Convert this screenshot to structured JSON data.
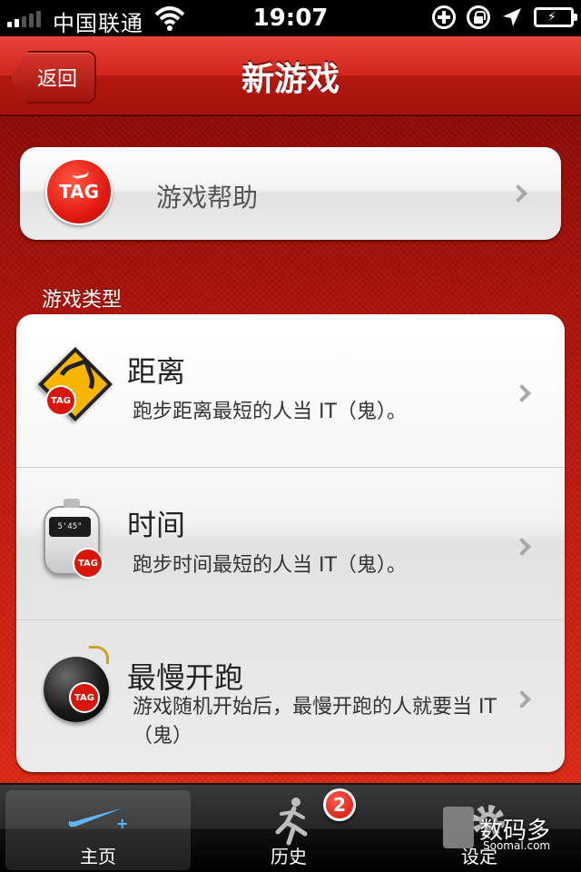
{
  "status_bar": {
    "carrier": "中国联通",
    "time": "19:07"
  },
  "nav": {
    "back_label": "返回",
    "title": "新游戏"
  },
  "help": {
    "icon_text": "TAG",
    "label": "游戏帮助"
  },
  "section": {
    "header": "游戏类型"
  },
  "game_types": [
    {
      "title": "距离",
      "description": "跑步距离最短的人当 IT（鬼）。",
      "icon": "distance-sign-icon",
      "icon_text": "TAG"
    },
    {
      "title": "时间",
      "description": "跑步时间最短的人当 IT（鬼）。",
      "icon": "stopwatch-icon",
      "icon_text": "TAG",
      "watch_display": "5'45\""
    },
    {
      "title": "最慢开跑",
      "description": "游戏随机开始后，最慢开跑的人就要当 IT （鬼）",
      "icon": "bomb-icon",
      "icon_text": "TAG"
    }
  ],
  "tabs": [
    {
      "label": "主页",
      "icon": "nike-swoosh-icon",
      "active": true
    },
    {
      "label": "历史",
      "icon": "runner-icon",
      "badge": "2"
    },
    {
      "label": "设定",
      "icon": "gear-icon"
    }
  ],
  "watermark": {
    "text": "数码多",
    "sub": "Soomal.com"
  },
  "colors": {
    "brand_red": "#d1261e",
    "tab_bar": "#000000",
    "card": "#f4f4f4"
  }
}
